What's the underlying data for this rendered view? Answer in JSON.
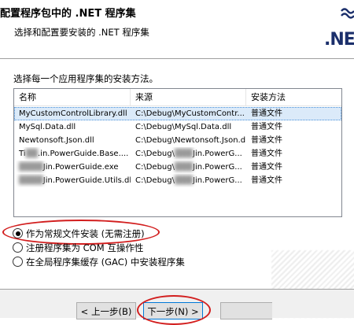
{
  "header": {
    "title": "配置程序包中的 .NET 程序集",
    "subtitle": "选择和配置要安装的 .NET 程序集",
    "logo_text": ".NE"
  },
  "instruction": "选择每一个应用程序集的安装方法。",
  "table": {
    "columns": [
      "名称",
      "来源",
      "安装方法"
    ],
    "rows": [
      {
        "name": "MyCustomControlLibrary.dll",
        "source": "C:\\Debug\\MyCustomContr...",
        "method": "普通文件",
        "selected": true
      },
      {
        "name": "MySql.Data.dll",
        "source": "C:\\Debug\\MySql.Data.dll",
        "method": "普通文件"
      },
      {
        "name": "Newtonsoft.Json.dll",
        "source": "C:\\Debug\\Newtonsoft.Json.dll",
        "method": "普通文件"
      },
      {
        "name_prefix": "Ti",
        "name": ".in.PowerGuide.Base....",
        "source_prefix": "C:\\Debug\\",
        "source": "Jin.PowerG...",
        "method": "普通文件"
      },
      {
        "name_prefix": "",
        "name": "Jin.PowerGuide.exe",
        "source_prefix": "C:\\Debug\\",
        "source": "Jin.PowerG...",
        "method": "普通文件"
      },
      {
        "name_prefix": "",
        "name": "Jin.PowerGuide.Utils.dll",
        "source_prefix": "C:\\Debug\\",
        "source": "Jin.PowerG...",
        "method": "普通文件"
      }
    ]
  },
  "options": [
    {
      "label": "作为常规文件安装 (无需注册)",
      "checked": true
    },
    {
      "label": "注册程序集为 COM 互操作性",
      "checked": false
    },
    {
      "label": "在全局程序集缓存 (GAC) 中安装程序集",
      "checked": false
    }
  ],
  "buttons": {
    "back": "< 上一步(B)",
    "next": "下一步(N) >"
  },
  "colors": {
    "highlight_red": "#d21e1e",
    "selection": "#dbeaf9",
    "logo_blue": "#1b2f6b"
  }
}
